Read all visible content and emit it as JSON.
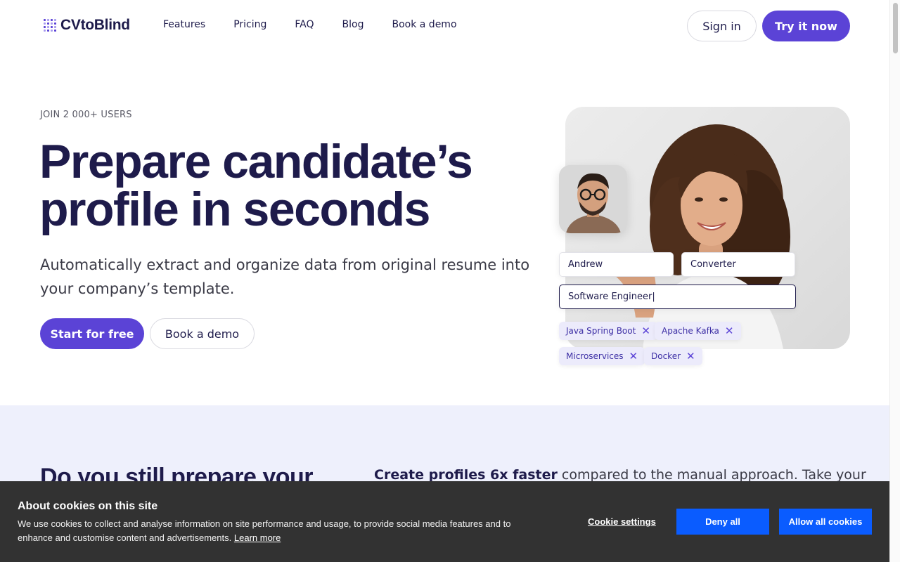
{
  "header": {
    "brand": "CVtoBlind",
    "nav": [
      {
        "label": "Features"
      },
      {
        "label": "Pricing"
      },
      {
        "label": "FAQ"
      },
      {
        "label": "Blog"
      },
      {
        "label": "Book a demo"
      }
    ],
    "sign_in": "Sign in",
    "try_now": "Try it now"
  },
  "hero": {
    "eyebrow": "JOIN 2 000+ USERS",
    "title_line1": "Prepare candidate’s",
    "title_line2": "profile in seconds",
    "subtitle": "Automatically extract and organize data from original resume into your company’s template.",
    "start_button": "Start for free",
    "demo_button": "Book a demo"
  },
  "profile_card": {
    "first_name": "Andrew",
    "last_name": "Converter",
    "job_title": "Software Engineer|",
    "tags": [
      "Java Spring Boot",
      "Apache Kafka",
      "Microservices",
      "Docker"
    ]
  },
  "section": {
    "title": "Do you still prepare your",
    "text_bold": "Create profiles 6x faster",
    "text_rest": " compared to the manual approach. Take your"
  },
  "cookie_banner": {
    "title": "About cookies on this site",
    "text": "We use cookies to collect and analyse information on site performance and usage, to provide social media features and to enhance and customise content and advertisements.",
    "learn_more": "Learn more",
    "settings": "Cookie settings",
    "deny": "Deny all",
    "allow": "Allow all cookies"
  },
  "colors": {
    "brand": "#5b43d6",
    "heading": "#1e1b4b",
    "band": "#eef0fc",
    "cookie_bg": "#323232",
    "cookie_button": "#0a5cff"
  }
}
